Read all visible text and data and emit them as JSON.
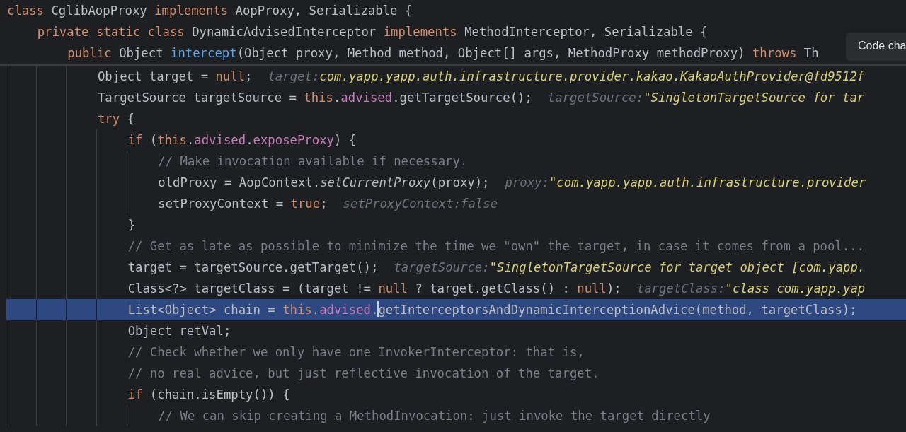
{
  "tooltip": {
    "text": "Code cha"
  },
  "code": [
    {
      "kind": "sticky",
      "tokens": [
        {
          "text": "class ",
          "kind": "keyword"
        },
        {
          "text": "CglibAopProxy ",
          "kind": "plain"
        },
        {
          "text": "implements ",
          "kind": "keyword"
        },
        {
          "text": "AopProxy, Serializable {",
          "kind": "plain"
        }
      ],
      "children": [
        {
          "kind": "sticky",
          "tokens": [
            {
              "text": "private static class ",
              "kind": "keyword"
            },
            {
              "text": "DynamicAdvisedInterceptor ",
              "kind": "plain"
            },
            {
              "text": "implements ",
              "kind": "keyword"
            },
            {
              "text": "MethodInterceptor, Serializable {",
              "kind": "plain"
            }
          ],
          "children": [
            {
              "kind": "sticky",
              "tokens": [
                {
                  "text": "public ",
                  "kind": "keyword"
                },
                {
                  "text": "Object ",
                  "kind": "plain"
                },
                {
                  "text": "intercept",
                  "kind": "declaration"
                },
                {
                  "text": "(Object proxy, Method method, Object[] args, MethodProxy methodProxy) ",
                  "kind": "plain"
                },
                {
                  "text": "throws ",
                  "kind": "keyword"
                },
                {
                  "text": "Th",
                  "kind": "plain"
                }
              ],
              "children": [
                {
                  "kind": "code",
                  "selected": false,
                  "tokens": [
                    {
                      "text": "Object target = ",
                      "kind": "plain"
                    },
                    {
                      "text": "null",
                      "kind": "keyword"
                    },
                    {
                      "text": ";",
                      "kind": "plain"
                    }
                  ],
                  "hint": {
                    "label": "target:",
                    "value": "com.yapp.yapp.auth.infrastructure.provider.kakao.KakaoAuthProvider@fd9512f",
                    "kind": "string"
                  }
                },
                {
                  "kind": "code",
                  "selected": false,
                  "tokens": [
                    {
                      "text": "TargetSource targetSource = ",
                      "kind": "plain"
                    },
                    {
                      "text": "this",
                      "kind": "keyword"
                    },
                    {
                      "text": ".",
                      "kind": "plain"
                    },
                    {
                      "text": "advised",
                      "kind": "field"
                    },
                    {
                      "text": ".getTargetSource();",
                      "kind": "plain"
                    }
                  ],
                  "hint": {
                    "label": "targetSource:",
                    "value": "\"SingletonTargetSource for tar",
                    "kind": "string"
                  }
                },
                {
                  "kind": "code",
                  "selected": false,
                  "tokens": [
                    {
                      "text": "try ",
                      "kind": "keyword"
                    },
                    {
                      "text": "{",
                      "kind": "plain"
                    }
                  ],
                  "children": [
                    {
                      "kind": "code",
                      "selected": false,
                      "tokens": [
                        {
                          "text": "if ",
                          "kind": "keyword"
                        },
                        {
                          "text": "(",
                          "kind": "plain"
                        },
                        {
                          "text": "this",
                          "kind": "keyword"
                        },
                        {
                          "text": ".",
                          "kind": "plain"
                        },
                        {
                          "text": "advised",
                          "kind": "field"
                        },
                        {
                          "text": ".",
                          "kind": "plain"
                        },
                        {
                          "text": "exposeProxy",
                          "kind": "field"
                        },
                        {
                          "text": ") {",
                          "kind": "plain"
                        }
                      ],
                      "children": [
                        {
                          "kind": "code",
                          "selected": false,
                          "tokens": [
                            {
                              "text": "// Make invocation available if necessary.",
                              "kind": "comment"
                            }
                          ]
                        },
                        {
                          "kind": "code",
                          "selected": false,
                          "tokens": [
                            {
                              "text": "oldProxy = AopContext.",
                              "kind": "plain"
                            },
                            {
                              "text": "setCurrentProxy",
                              "kind": "static"
                            },
                            {
                              "text": "(proxy);",
                              "kind": "plain"
                            }
                          ],
                          "hint": {
                            "label": "proxy:",
                            "value": "\"com.yapp.yapp.auth.infrastructure.provider",
                            "kind": "string"
                          }
                        },
                        {
                          "kind": "code",
                          "selected": false,
                          "tokens": [
                            {
                              "text": "setProxyContext = ",
                              "kind": "plain"
                            },
                            {
                              "text": "true",
                              "kind": "keyword"
                            },
                            {
                              "text": ";",
                              "kind": "plain"
                            }
                          ],
                          "hint": {
                            "label": "setProxyContext:",
                            "value": "false",
                            "kind": "plain"
                          }
                        }
                      ]
                    },
                    {
                      "kind": "code",
                      "selected": false,
                      "tokens": [
                        {
                          "text": "}",
                          "kind": "plain"
                        }
                      ]
                    },
                    {
                      "kind": "code",
                      "selected": false,
                      "tokens": [
                        {
                          "text": "// Get as late as possible to minimize the time we \"own\" the target, in case it comes from a pool...",
                          "kind": "comment"
                        }
                      ]
                    },
                    {
                      "kind": "code",
                      "selected": false,
                      "tokens": [
                        {
                          "text": "target = targetSource.getTarget();",
                          "kind": "plain"
                        }
                      ],
                      "hint": {
                        "label": "targetSource:",
                        "value": "\"SingletonTargetSource for target object [com.yapp.",
                        "kind": "string"
                      }
                    },
                    {
                      "kind": "code",
                      "selected": false,
                      "tokens": [
                        {
                          "text": "Class<?> targetClass = (target != ",
                          "kind": "plain"
                        },
                        {
                          "text": "null",
                          "kind": "keyword"
                        },
                        {
                          "text": " ? target.getClass() : ",
                          "kind": "plain"
                        },
                        {
                          "text": "null",
                          "kind": "keyword"
                        },
                        {
                          "text": ");",
                          "kind": "plain"
                        }
                      ],
                      "hint": {
                        "label": "targetClass:",
                        "value": "\"class com.yapp.yap",
                        "kind": "string"
                      }
                    },
                    {
                      "kind": "code",
                      "selected": true,
                      "tokens": [
                        {
                          "text": "List<Object> chain = ",
                          "kind": "plain"
                        },
                        {
                          "text": "this",
                          "kind": "keyword"
                        },
                        {
                          "text": ".advised.",
                          "kind": "member",
                          "caret_after": true
                        },
                        {
                          "text": "getInterceptorsAndDynamicInterceptionAdvice(method, targetClass);",
                          "kind": "plain"
                        }
                      ]
                    },
                    {
                      "kind": "code",
                      "selected": false,
                      "tokens": [
                        {
                          "text": "Object retVal;",
                          "kind": "plain"
                        }
                      ]
                    },
                    {
                      "kind": "code",
                      "selected": false,
                      "tokens": [
                        {
                          "text": "// Check whether we only have one InvokerInterceptor: that is,",
                          "kind": "comment"
                        }
                      ]
                    },
                    {
                      "kind": "code",
                      "selected": false,
                      "tokens": [
                        {
                          "text": "// no real advice, but just reflective invocation of the target.",
                          "kind": "comment"
                        }
                      ]
                    },
                    {
                      "kind": "code",
                      "selected": false,
                      "tokens": [
                        {
                          "text": "if ",
                          "kind": "keyword"
                        },
                        {
                          "text": "(chain.isEmpty()) {",
                          "kind": "plain"
                        }
                      ],
                      "children": [
                        {
                          "kind": "code",
                          "selected": false,
                          "tokens": [
                            {
                              "text": "// We can skip creating a MethodInvocation: just invoke the target directly",
                              "kind": "comment"
                            }
                          ]
                        }
                      ]
                    }
                  ]
                }
              ]
            }
          ]
        }
      ]
    }
  ]
}
